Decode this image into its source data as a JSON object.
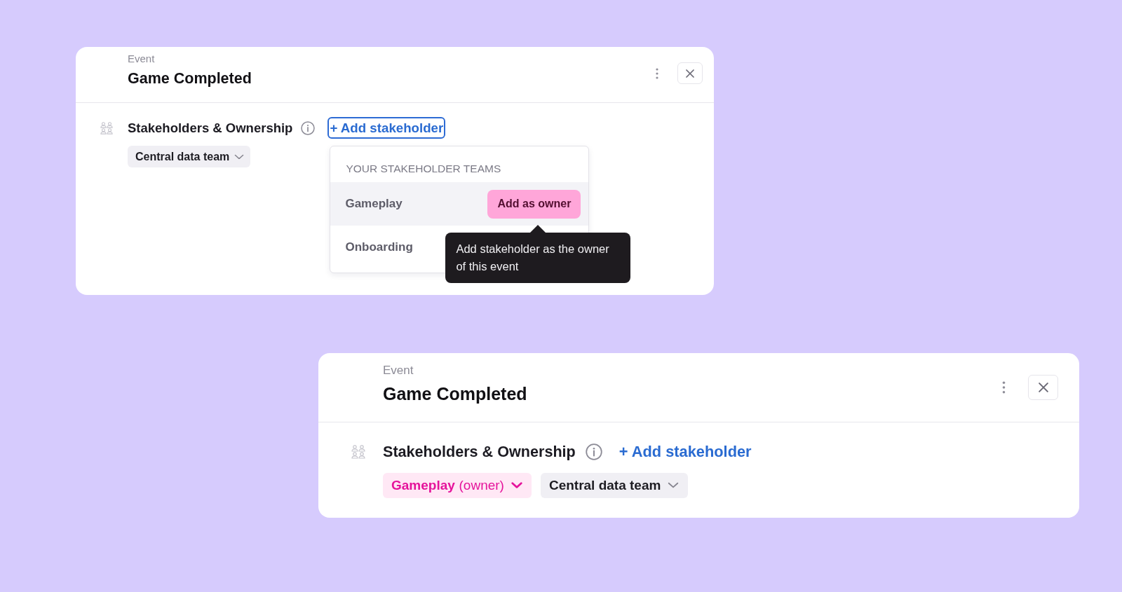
{
  "panels": [
    {
      "eyebrow": "Event",
      "title": "Game Completed",
      "section": {
        "title": "Stakeholders & Ownership",
        "add_button": {
          "label": "+ Add stakeholder",
          "focused": true
        },
        "stakeholders": [
          {
            "name": "Central data team",
            "owner": false
          }
        ]
      },
      "menu": {
        "heading": "YOUR STAKEHOLDER TEAMS",
        "items": [
          {
            "label": "Gameplay",
            "hovered": true,
            "action": {
              "label": "Add as owner",
              "tooltip": "Add stakeholder as the owner of this event"
            }
          },
          {
            "label": "Onboarding",
            "hovered": false
          }
        ]
      }
    },
    {
      "eyebrow": "Event",
      "title": "Game Completed",
      "section": {
        "title": "Stakeholders & Ownership",
        "add_button": {
          "label": "+ Add stakeholder",
          "focused": false
        },
        "stakeholders": [
          {
            "name": "Gameplay",
            "role": "(owner)",
            "owner": true
          },
          {
            "name": "Central data team",
            "owner": false
          }
        ]
      }
    }
  ]
}
